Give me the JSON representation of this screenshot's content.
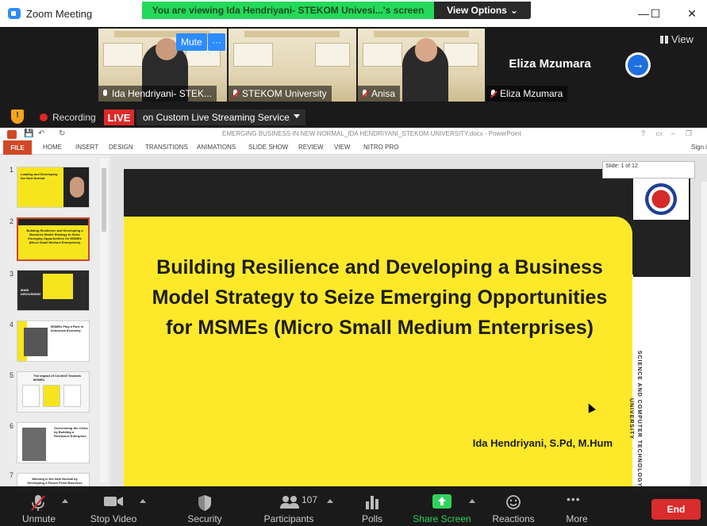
{
  "window": {
    "title": "Zoom Meeting",
    "minimize_glyph": "—",
    "maximize_glyph": "☐",
    "close_glyph": "✕"
  },
  "banner": {
    "viewing_text": "You are viewing Ida Hendriyani- STEKOM Univesi...'s screen",
    "view_options_label": "View Options",
    "caret": "⌄"
  },
  "gallery": {
    "participants": [
      {
        "name": "Ida Hendriyani- STEK...",
        "active": true
      },
      {
        "name": "STEKOM University",
        "active": false
      },
      {
        "name": "Anisa",
        "active": false
      },
      {
        "name": "Eliza Mzumara",
        "big_name": "Eliza Mzumara",
        "active": false
      }
    ],
    "mute_label": "Mute",
    "more_label": "···",
    "next_glyph": "→",
    "view_label": "View"
  },
  "status": {
    "recording_label": "Recording",
    "live_label": "LIVE",
    "live_service": "on Custom Live Streaming Service"
  },
  "powerpoint": {
    "doc_title": "EMERGING BUSINESS IN NEW NORMAL_IDA HENDRIYANI_STEKOM UNIVERSITY.docx - PowerPoint",
    "ribbon_tabs": [
      "FILE",
      "HOME",
      "INSERT",
      "DESIGN",
      "TRANSITIONS",
      "ANIMATIONS",
      "SLIDE SHOW",
      "REVIEW",
      "VIEW",
      "NITRO PRO"
    ],
    "sign_in": "Sign i",
    "slide_indicator": "Slide: 1 of 12",
    "thumbnail_numbers": [
      "1",
      "2",
      "3",
      "4",
      "5",
      "6",
      "7"
    ],
    "thumbnails": {
      "t1": "Loading and Developing the New Normal",
      "t2": "Building Resilience and Developing a Business Model Strategy to Seize Emerging Opportunities for MSMEs (Micro Small Medium Enterprises)",
      "t3": "MAIN DISCUSSION",
      "t4": "MSMEs Play a Role in Indonesia Economy",
      "t5": "The Impact of Covid19 Towards MSMEs",
      "t6": "Overcoming the Crisis by Building a Resilience Enterprise",
      "t7": "Winning in the New Normal by Developing a Future-Proof Business"
    },
    "slide": {
      "headline": "Building Resilience and Developing a Business Model Strategy to Seize Emerging Opportunities for MSMEs (Micro Small Medium Enterprises)",
      "author": "Ida Hendriyani, S.Pd, M.Hum",
      "vertical_text": "SCIENCE AND COMPUTER TECHNOLOGY UNIVERSITY"
    }
  },
  "toolbar": {
    "unmute": "Unmute",
    "stop_video": "Stop Video",
    "security": "Security",
    "participants": "Participants",
    "participant_count": "107",
    "polls": "Polls",
    "share_screen": "Share Screen",
    "reactions": "Reactions",
    "more": "More",
    "more_glyph": "•••",
    "end": "End"
  },
  "colors": {
    "zoom_blue": "#2d8cff",
    "banner_green": "#23d959",
    "live_red": "#e02828",
    "slide_yellow": "#fde92a",
    "ppt_orange": "#d24726",
    "share_green": "#2fd35b"
  }
}
